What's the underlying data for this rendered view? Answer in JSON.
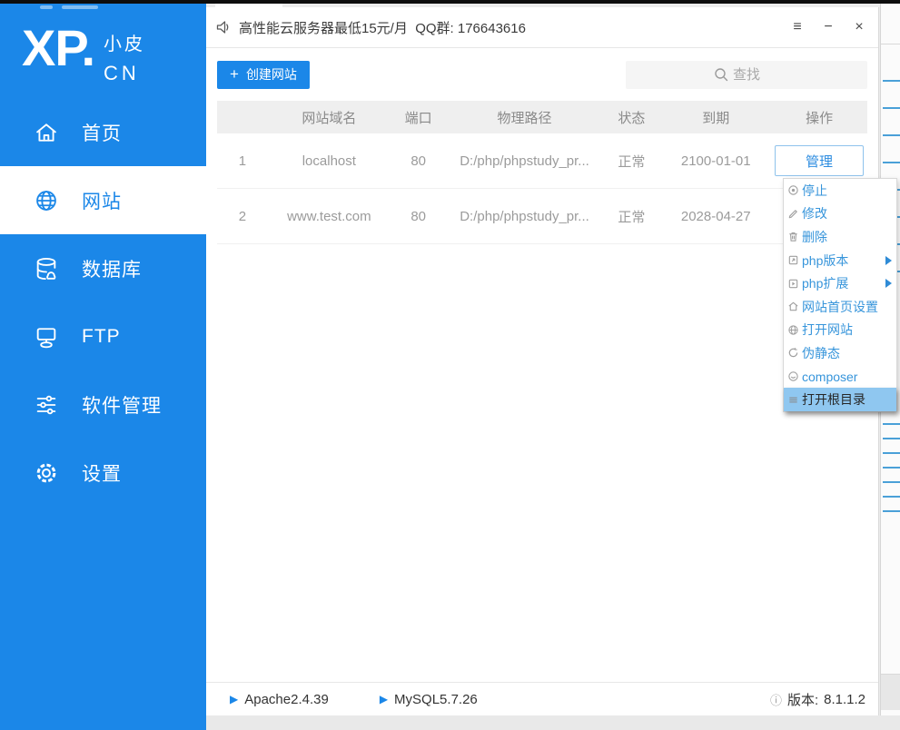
{
  "window": {
    "announcement": "高性能云服务器最低15元/月  QQ群: 176643616",
    "controls": [
      {
        "name": "menu",
        "glyph": "≡"
      },
      {
        "name": "minimize",
        "glyph": "−"
      },
      {
        "name": "close",
        "glyph": "×"
      }
    ]
  },
  "brand": {
    "logo_main": "XP.",
    "logo_sub_top": "小皮",
    "logo_sub_bottom": "CN"
  },
  "sidebar": {
    "items": [
      {
        "label": "首页",
        "icon": "home-icon",
        "active": false
      },
      {
        "label": "网站",
        "icon": "globe-icon",
        "active": true
      },
      {
        "label": "数据库",
        "icon": "database-icon",
        "active": false
      },
      {
        "label": "FTP",
        "icon": "ftp-icon",
        "active": false
      },
      {
        "label": "软件管理",
        "icon": "sliders-icon",
        "active": false
      },
      {
        "label": "设置",
        "icon": "gear-icon",
        "active": false
      }
    ]
  },
  "toolbar": {
    "create_icon": "+",
    "create_button": "创建网站",
    "search_placeholder": "查找"
  },
  "table": {
    "headers": [
      "",
      "网站域名",
      "端口",
      "物理路径",
      "状态",
      "到期",
      "操作"
    ],
    "rows": [
      {
        "index": "1",
        "domain": "localhost",
        "port": "80",
        "path": "D:/php/phpstudy_pr...",
        "status": "正常",
        "expire": "2100-01-01",
        "action": "管理"
      },
      {
        "index": "2",
        "domain": "www.test.com",
        "port": "80",
        "path": "D:/php/phpstudy_pr...",
        "status": "正常",
        "expire": "2028-04-27",
        "action": ""
      }
    ]
  },
  "context_menu": {
    "items": [
      {
        "label": "停止",
        "icon": "stop-icon",
        "submenu": false,
        "highlighted": false
      },
      {
        "label": "修改",
        "icon": "edit-icon",
        "submenu": false,
        "highlighted": false
      },
      {
        "label": "删除",
        "icon": "delete-icon",
        "submenu": false,
        "highlighted": false
      },
      {
        "label": "php版本",
        "icon": "php-version-icon",
        "submenu": true,
        "highlighted": false
      },
      {
        "label": "php扩展",
        "icon": "php-extension-icon",
        "submenu": true,
        "highlighted": false
      },
      {
        "label": "网站首页设置",
        "icon": "homepage-icon",
        "submenu": false,
        "highlighted": false
      },
      {
        "label": "打开网站",
        "icon": "open-site-icon",
        "submenu": false,
        "highlighted": false
      },
      {
        "label": "伪静态",
        "icon": "rewrite-icon",
        "submenu": false,
        "highlighted": false
      },
      {
        "label": "composer",
        "icon": "composer-icon",
        "submenu": false,
        "highlighted": false
      },
      {
        "label": "打开根目录",
        "icon": "open-root-icon",
        "submenu": false,
        "highlighted": true
      }
    ]
  },
  "statusbar": {
    "play_glyph": "▶",
    "services": [
      {
        "name": "Apache2.4.39"
      },
      {
        "name": "MySQL5.7.26"
      }
    ],
    "info_glyph": "ⓘ",
    "version_label": "版本:",
    "version": "8.1.1.2"
  },
  "colors": {
    "accent_blue": "#1b87e8",
    "menu_text_blue": "#3795db",
    "menu_highlight_bg": "#8fc7f0",
    "table_text_gray": "#9b9b9b",
    "header_bg": "#efefef",
    "bg_line_blue": "#4aa0d8"
  }
}
